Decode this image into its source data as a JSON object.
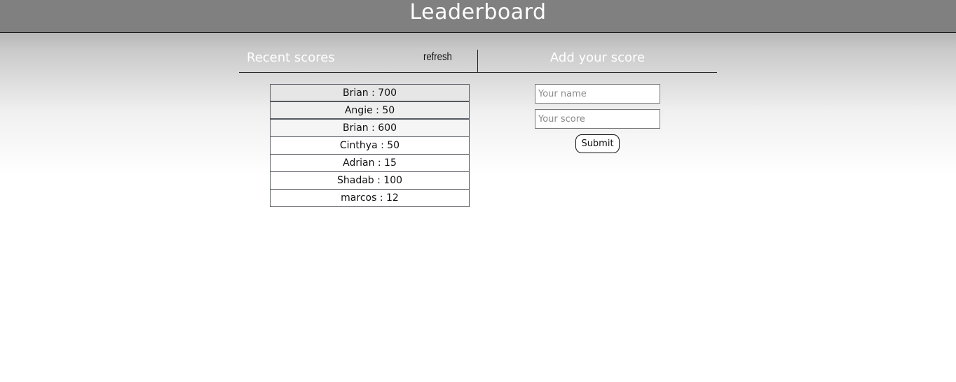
{
  "header": {
    "title": "Leaderboard"
  },
  "recent": {
    "title": "Recent scores",
    "refresh_label": "refresh",
    "scores": [
      "Brian : 700",
      "Angie : 50",
      "Brian : 600",
      "Cinthya : 50",
      "Adrian : 15",
      "Shadab : 100",
      "marcos : 12"
    ]
  },
  "form": {
    "title": "Add your score",
    "name_placeholder": "Your name",
    "score_placeholder": "Your score",
    "name_value": "",
    "score_value": "",
    "submit_label": "Submit"
  },
  "colors": {
    "header_bg": "#808080",
    "header_text": "#ffffff",
    "border": "#555a60"
  }
}
